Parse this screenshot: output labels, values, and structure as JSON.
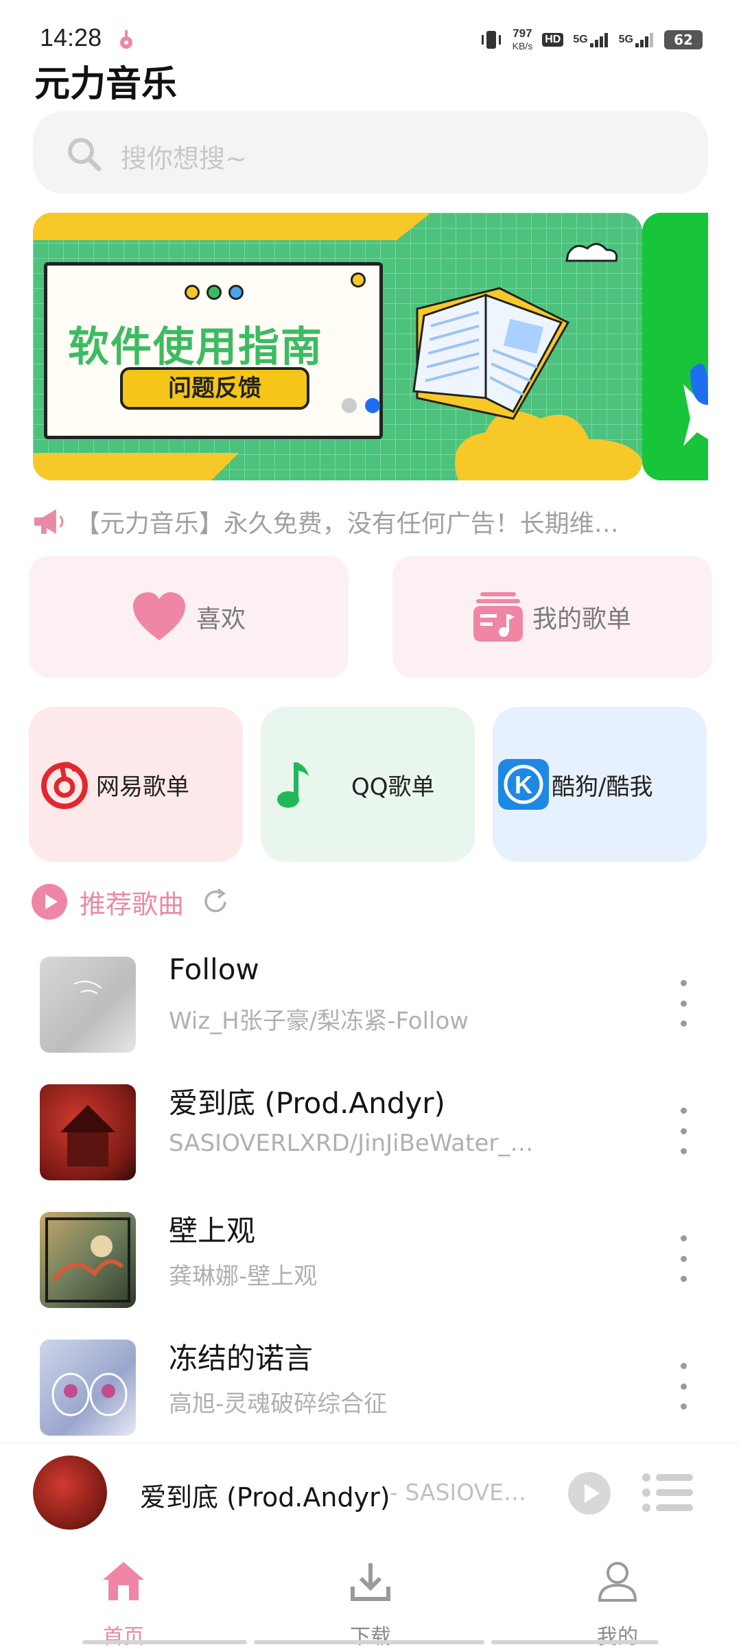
{
  "status": {
    "time": "14:28",
    "net_speed_value": "797",
    "net_speed_unit": "KB/s",
    "hd_label": "HD",
    "sim1_label": "5G",
    "sim2_label": "5G",
    "battery": "62"
  },
  "app_title": "元力音乐",
  "search": {
    "placeholder": "搜你想搜~"
  },
  "banner": {
    "title": "软件使用指南",
    "button_label": "问题反馈"
  },
  "notice": {
    "text": "【元力音乐】永久免费，没有任何广告！长期维…"
  },
  "quick_cards": [
    {
      "label": "喜欢",
      "icon": "heart-icon"
    },
    {
      "label": "我的歌单",
      "icon": "playlist-icon"
    }
  ],
  "platforms": [
    {
      "label": "网易歌单",
      "icon": "netease-icon"
    },
    {
      "label": "QQ歌单",
      "icon": "qq-music-icon"
    },
    {
      "label": "酷狗/酷我",
      "icon": "kugou-icon"
    }
  ],
  "recommend": {
    "title": "推荐歌曲"
  },
  "songs": [
    {
      "title": "Follow",
      "subtitle": "Wiz_H张子豪/梨冻紧-Follow"
    },
    {
      "title": "爱到底 (Prod.Andyr)",
      "subtitle": "SASIOVERLXRD/JinJiBeWater_…"
    },
    {
      "title": "壁上观",
      "subtitle": "龚琳娜-壁上观"
    },
    {
      "title": "冻结的诺言",
      "subtitle": "高旭-灵魂破碎综合征"
    }
  ],
  "player": {
    "title": "爱到底 (Prod.Andyr)",
    "subtitle": "- SASIOVER…"
  },
  "nav": [
    {
      "label": "首页",
      "icon": "home-icon"
    },
    {
      "label": "下载",
      "icon": "download-icon"
    },
    {
      "label": "我的",
      "icon": "user-icon"
    }
  ],
  "colors": {
    "accent_pink": "#e98aa5",
    "netease_red": "#e0282e",
    "qq_green": "#1fb95a",
    "kugou_blue": "#1e88e5"
  }
}
